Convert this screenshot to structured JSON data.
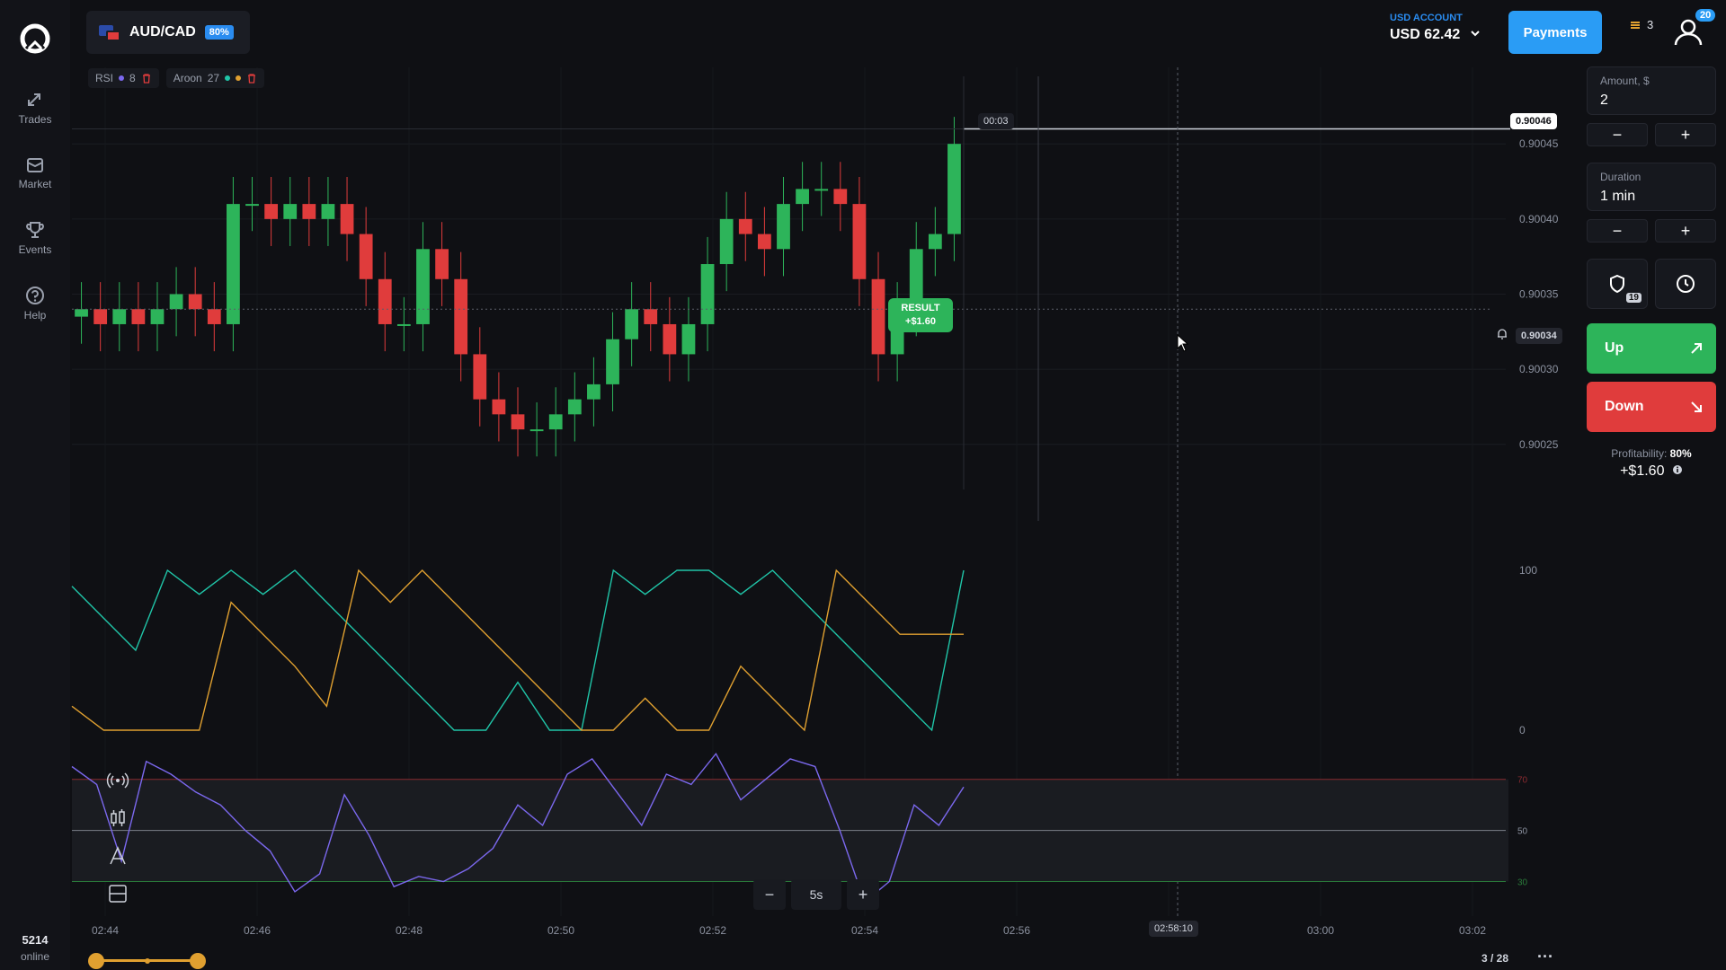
{
  "sidebar": {
    "items": [
      {
        "label": "Trades",
        "icon": "trades-icon"
      },
      {
        "label": "Market",
        "icon": "market-icon"
      },
      {
        "label": "Events",
        "icon": "trophy-icon"
      },
      {
        "label": "Help",
        "icon": "help-icon"
      }
    ],
    "online_count": "5214",
    "online_label": "online"
  },
  "asset": {
    "pair": "AUD/CAD",
    "payout": "80%"
  },
  "indicators": {
    "rsi": {
      "label": "RSI",
      "period": "8",
      "color": "#7b68ee"
    },
    "aroon": {
      "label": "Aroon",
      "period": "27",
      "up_color": "#20c5a8",
      "down_color": "#e0a030"
    }
  },
  "account": {
    "label": "USD ACCOUNT",
    "balance": "USD 62.42"
  },
  "header": {
    "payments_label": "Payments",
    "coins": "3",
    "notifications": "20"
  },
  "trade_panel": {
    "amount_label": "Amount, $",
    "amount_value": "2",
    "duration_label": "Duration",
    "duration_value": "1 min",
    "shield_badge": "19",
    "up_label": "Up",
    "down_label": "Down",
    "profitability_label": "Profitability:",
    "profitability_value": "80%",
    "profit_amount": "+$1.60"
  },
  "chart_tags": {
    "timer": "00:03",
    "current_price": "0.90046",
    "marker_price": "0.90034",
    "result_label": "RESULT",
    "result_value": "+$1.60",
    "crosshair_time": "02:58:10"
  },
  "chart_controls": {
    "zoom_out": "−",
    "timeframe": "5s",
    "zoom_in": "+"
  },
  "pagination": {
    "page": "3 / 28"
  },
  "colors": {
    "up": "#2db45a",
    "down": "#e03c3c",
    "accent": "#2a9cf5",
    "background": "#0f1014"
  },
  "chart_data": [
    {
      "type": "candlestick",
      "title": "AUD/CAD",
      "x_ticks": [
        "02:44",
        "02:46",
        "02:48",
        "02:50",
        "02:52",
        "02:54",
        "02:56",
        "02:58:10",
        "03:00",
        "03:02"
      ],
      "y_ticks": [
        "0.90045",
        "0.90040",
        "0.90035",
        "0.90030",
        "0.90025"
      ],
      "ylim": [
        0.90022,
        0.90048
      ],
      "close": [
        0.90034,
        0.90033,
        0.90034,
        0.90033,
        0.90034,
        0.90035,
        0.90034,
        0.90033,
        0.90041,
        0.90041,
        0.9004,
        0.90041,
        0.9004,
        0.90041,
        0.90039,
        0.90036,
        0.90033,
        0.90033,
        0.90038,
        0.90036,
        0.90031,
        0.90028,
        0.90027,
        0.90026,
        0.90026,
        0.90027,
        0.90028,
        0.90029,
        0.90032,
        0.90034,
        0.90033,
        0.90031,
        0.90033,
        0.90037,
        0.9004,
        0.90039,
        0.90038,
        0.90041,
        0.90042,
        0.90042,
        0.90041,
        0.90036,
        0.90031,
        0.90034,
        0.90038,
        0.90039,
        0.90045
      ]
    },
    {
      "type": "line",
      "title": "Aroon",
      "y_ticks": [
        "100",
        "0"
      ],
      "ylim": [
        0,
        100
      ],
      "series": [
        {
          "name": "Aroon Up",
          "color": "#20c5a8",
          "values": [
            90,
            70,
            50,
            100,
            85,
            100,
            85,
            100,
            80,
            60,
            40,
            20,
            0,
            0,
            30,
            0,
            0,
            100,
            85,
            100,
            100,
            85,
            100,
            80,
            60,
            40,
            20,
            0,
            100
          ]
        },
        {
          "name": "Aroon Down",
          "color": "#e0a030",
          "values": [
            15,
            0,
            0,
            0,
            0,
            80,
            60,
            40,
            15,
            100,
            80,
            100,
            80,
            60,
            40,
            20,
            0,
            0,
            20,
            0,
            0,
            40,
            20,
            0,
            100,
            80,
            60,
            60,
            60
          ]
        }
      ]
    },
    {
      "type": "line",
      "title": "RSI",
      "y_ticks": [
        "70",
        "50",
        "30"
      ],
      "ylim": [
        20,
        85
      ],
      "series": [
        {
          "name": "RSI",
          "color": "#7b68ee",
          "values": [
            75,
            68,
            38,
            77,
            72,
            65,
            60,
            50,
            42,
            26,
            33,
            64,
            48,
            28,
            32,
            30,
            35,
            43,
            60,
            52,
            72,
            78,
            65,
            52,
            72,
            68,
            80,
            62,
            70,
            78,
            75,
            50,
            22,
            30,
            60,
            52,
            67
          ]
        }
      ]
    }
  ]
}
